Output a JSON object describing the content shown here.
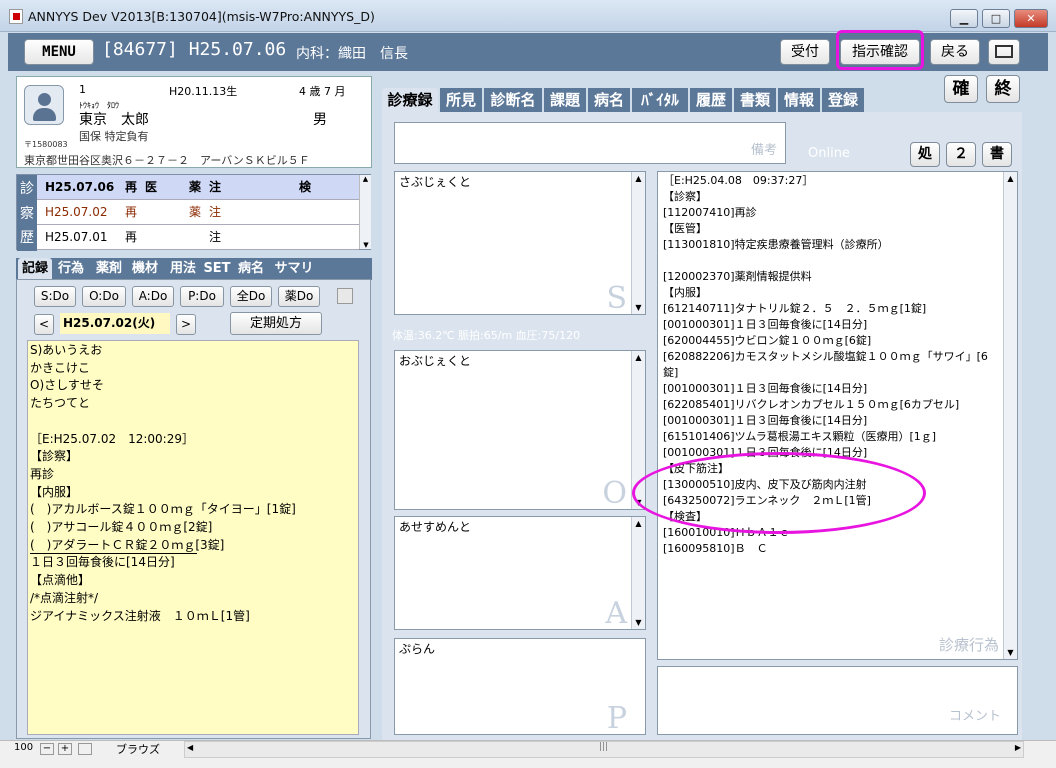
{
  "window": {
    "title": "ANNYYS Dev V2013[B:130704](msis-W7Pro:ANNYYS_D)"
  },
  "header": {
    "menu_label": "MENU",
    "patient_id_date": "[84677] H25.07.06",
    "department_doctor": "内科：織田　信長",
    "buttons": {
      "reception": "受付",
      "confirm_orders": "指示確認",
      "back": "戻る"
    }
  },
  "patient": {
    "number": "1",
    "birthdate": "H20.11.13生",
    "age": "4 歳 7 月",
    "kana": "ﾄｳｷｮｳ　ﾀﾛｳ",
    "name": "東京　太郎",
    "sex": "男",
    "insurance": "国保 特定負有",
    "postal": "〒1580083",
    "address": "東京都世田谷区奥沢６－２７－２　アーバンＳＫビル５Ｆ"
  },
  "history": {
    "label": "診察歴",
    "rows": [
      {
        "date": "H25.07.06",
        "a": "再",
        "b": "医",
        "c": "薬",
        "d": "注",
        "e": "検"
      },
      {
        "date": "H25.07.02",
        "a": "再",
        "b": "",
        "c": "薬",
        "d": "注",
        "e": ""
      },
      {
        "date": "H25.07.01",
        "a": "再",
        "b": "",
        "c": "",
        "d": "注",
        "e": ""
      }
    ]
  },
  "left_tabs": [
    "記録",
    "行為",
    "薬剤",
    "機材",
    "用法",
    "SET",
    "病名",
    "サマリ"
  ],
  "soap_buttons": [
    "S:Do",
    "O:Do",
    "A:Do",
    "P:Do",
    "全Do",
    "薬Do"
  ],
  "date_nav": {
    "prev": "<",
    "date": "H25.07.02(火)",
    "next": ">",
    "regular_rx": "定期処方"
  },
  "note_text": "S)あいうえお\nかきこけこ\nO)さしすせそ\nたちつてと\n\n［E:H25.07.02　12:00:29］\n【診察】\n再診\n【内服】\n(　)アカルボース錠１００ｍｇ「タイヨー」[1錠]\n(　)アサコール錠４００ｍｇ[2錠]\n(　)アダラートＣＲ錠２０ｍｇ[3錠]\n１日３回毎食後に[14日分]\n【点滴他】\n/*点滴注射*/\nジアイナミックス注射液　１０ｍＬ[1管]",
  "right_tabs": [
    "診療録",
    "所見",
    "診断名",
    "課題",
    "病名",
    "ﾊﾞｲﾀﾙ",
    "履歴",
    "書類",
    "情報",
    "登録"
  ],
  "big_buttons": {
    "confirm": "確",
    "end": "終"
  },
  "remarks_placeholder": "備考",
  "online": "Online",
  "small_buttons": [
    "処",
    "２",
    "書"
  ],
  "soap": {
    "s": {
      "label": "さぶじぇくと",
      "letter": "S"
    },
    "o": {
      "label": "おぶじぇくと",
      "letter": "O"
    },
    "a": {
      "label": "あせすめんと",
      "letter": "A"
    },
    "p": {
      "label": "ぷらん",
      "letter": "P"
    }
  },
  "vitals": "体温:36.2℃ 脈拍:65/m 血圧:75/120",
  "actions_label": "診療行為",
  "comment_label": "コメント",
  "actions": [
    "［E:H25.04.08　09:37:27］",
    "【診察】",
    "[112007410]再診",
    "【医管】",
    "[113001810]特定疾患療養管理料（診療所）",
    "",
    "[120002370]薬剤情報提供料",
    "【内服】",
    "[612140711]タナトリル錠２．５　２．５ｍｇ[1錠]",
    "[001000301]１日３回毎食後に[14日分]",
    "[620004455]ウビロン錠１００ｍｇ[6錠]",
    "[620882206]カモスタットメシル酸塩錠１００ｍｇ「サワイ」[6",
    "錠]",
    "[001000301]１日３回毎食後に[14日分]",
    "[622085401]リバクレオンカプセル１５０ｍｇ[6カプセル]",
    "[001000301]１日３回毎食後に[14日分]",
    "[615101406]ツムラ葛根湯エキス顆粒（医療用）[1ｇ]",
    "[001000301]１日３回毎食後に[14日分]",
    "【皮下筋注】",
    "[130000510]皮内、皮下及び筋肉内注射",
    "[643250072]ラエンネック　２ｍＬ[1管]",
    "【検査】",
    "[160010010]ＨｂＡ１ｃ",
    "[160095810]Ｂ　Ｃ"
  ],
  "statusbar": {
    "zoom": "100",
    "mode": "ブラウズ"
  },
  "colors": {
    "header_bg": "#5c7899",
    "highlight": "#e815e0",
    "note_bg": "#fffdc4",
    "history_selected": "#cfd8f5"
  }
}
